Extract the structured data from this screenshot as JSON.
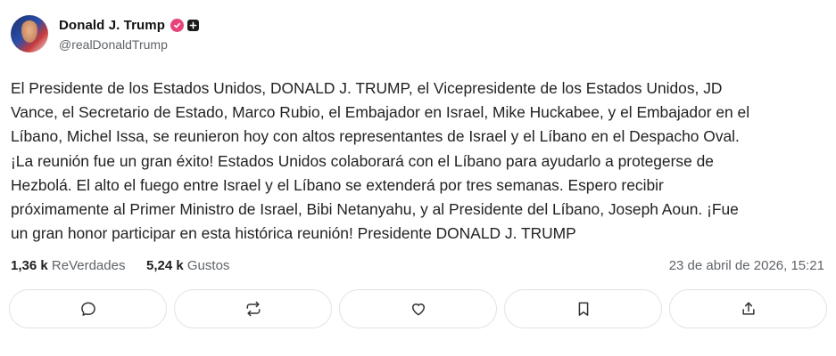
{
  "author": {
    "display_name": "Donald J. Trump",
    "handle": "@realDonaldTrump",
    "verified_icon": "verified-badge-icon",
    "extra_icon": "plus-icon"
  },
  "post": {
    "text": "El Presidente de los Estados Unidos, DONALD J. TRUMP, el Vicepresidente de los Estados Unidos, JD\nVance, el Secretario de Estado, Marco Rubio, el Embajador en Israel, Mike Huckabee, y el Embajador en el\nLíbano, Michel Issa, se reunieron hoy con altos representantes de Israel y el Líbano en el Despacho Oval.\n¡La reunión fue un gran éxito! Estados Unidos colaborará con el Líbano para ayudarlo a protegerse de\nHezbolá. El alto el fuego entre Israel y el Líbano se extenderá por tres semanas. Espero recibir\npróximamente al Primer Ministro de Israel, Bibi Netanyahu, y al Presidente del Líbano, Joseph Aoun. ¡Fue\nun gran honor participar en esta histórica reunión! Presidente DONALD J. TRUMP"
  },
  "stats": {
    "reposts_count": "1,36 k",
    "reposts_label": "ReVerdades",
    "likes_count": "5,24 k",
    "likes_label": "Gustos",
    "timestamp": "23 de abril de 2026, 15:21"
  },
  "actions": [
    {
      "icon": "reply-icon"
    },
    {
      "icon": "repost-icon"
    },
    {
      "icon": "like-icon"
    },
    {
      "icon": "bookmark-icon"
    },
    {
      "icon": "share-icon"
    }
  ],
  "colors": {
    "badge": "#e6457b",
    "text": "#222222",
    "muted": "#5f6368",
    "border": "#e2e2e2"
  }
}
